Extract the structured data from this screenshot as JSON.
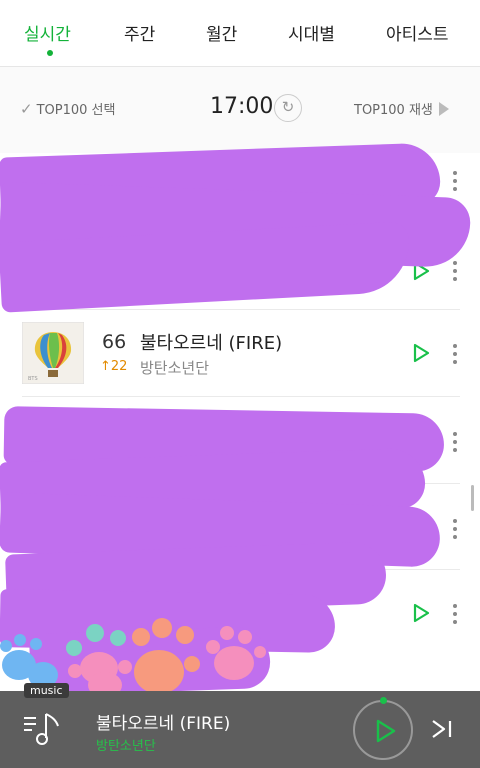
{
  "tabs": [
    {
      "label": "실시간",
      "active": true
    },
    {
      "label": "주간",
      "active": false
    },
    {
      "label": "월간",
      "active": false
    },
    {
      "label": "시대별",
      "active": false
    },
    {
      "label": "아티스트",
      "active": false
    }
  ],
  "chart_header": {
    "select_label": "TOP100 선택",
    "time": "17:00",
    "play_all_label": "TOP100 재생"
  },
  "visible_song": {
    "rank": "66",
    "change": "↑22",
    "title": "불타오르네 (FIRE)",
    "artist": "방탄소년단"
  },
  "player": {
    "tag": "music",
    "title": "불타오르네 (FIRE)",
    "artist": "방탄소년단"
  },
  "colors": {
    "accent": "#13b239",
    "redaction": "#c06fee",
    "player_bg": "#5e5e5e"
  }
}
